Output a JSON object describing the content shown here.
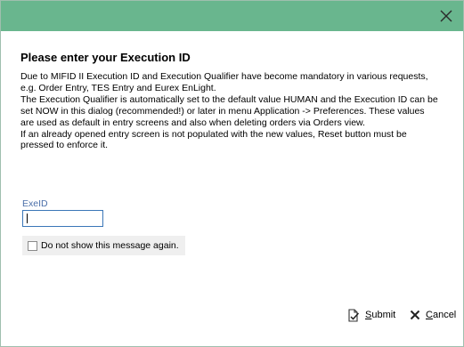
{
  "dialog": {
    "heading": "Please enter your Execution ID",
    "paragraphs": [
      "Due to MIFID II Execution ID and Execution Qualifier have become mandatory in various requests, e.g. Order Entry, TES Entry and Eurex EnLight.",
      "The Execution Qualifier is automatically set to the default value HUMAN and the Execution ID can be set NOW in this dialog (recommended!) or later in menu Application -> Preferences. These values are used as default in entry screens and also when deleting orders via Orders view.",
      "If an already opened entry screen is not populated with the new values, Reset button must be pressed to enforce it."
    ],
    "exe_id": {
      "label": "ExeID",
      "value": ""
    },
    "dont_show": {
      "label": "Do not show this message again.",
      "checked": false
    },
    "buttons": {
      "submit_first": "S",
      "submit_rest": "ubmit",
      "cancel_first": "C",
      "cancel_rest": "ancel"
    }
  },
  "colors": {
    "titlebar": "#69b68e",
    "label": "#4b6fa9",
    "input_border": "#3b77b8"
  },
  "icons": {
    "close": "close-icon",
    "submit": "submit-document-icon",
    "cancel": "cancel-x-icon"
  }
}
